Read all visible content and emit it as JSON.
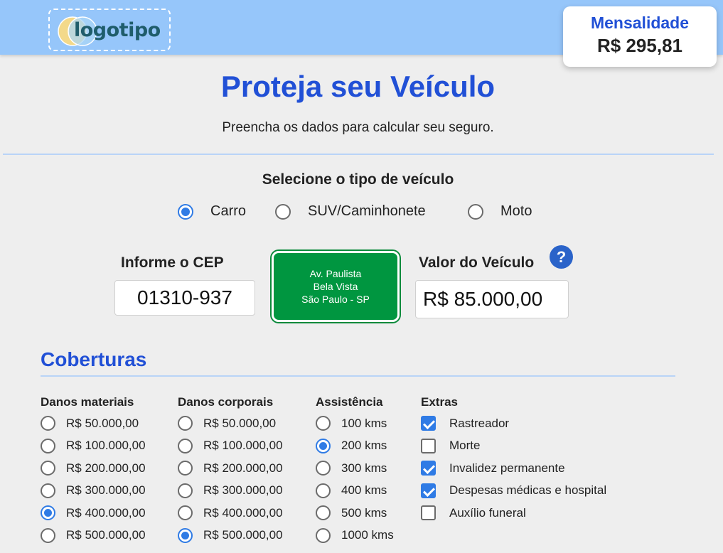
{
  "header": {
    "logo_text": "logotipo",
    "price_label": "Mensalidade",
    "price_value": "R$ 295,81"
  },
  "hero": {
    "title": "Proteja seu Veículo",
    "subtitle": "Preencha os dados para calcular seu seguro."
  },
  "vehicle_type": {
    "title": "Selecione o tipo de veículo",
    "options": [
      {
        "label": "Carro",
        "selected": true
      },
      {
        "label": "SUV/Caminhonete",
        "selected": false
      },
      {
        "label": "Moto",
        "selected": false
      }
    ]
  },
  "cep": {
    "label": "Informe o CEP",
    "value": "01310-937"
  },
  "address": {
    "street": "Av. Paulista",
    "district": "Bela Vista",
    "city": "São Paulo - SP"
  },
  "vehicle_value": {
    "label": "Valor do Veículo",
    "help_icon": "?",
    "value": "R$ 85.000,00"
  },
  "coverages": {
    "title": "Coberturas",
    "danos_materiais": {
      "title": "Danos materiais",
      "options": [
        "R$ 50.000,00",
        "R$ 100.000,00",
        "R$ 200.000,00",
        "R$ 300.000,00",
        "R$ 400.000,00",
        "R$ 500.000,00"
      ],
      "selected_index": 4
    },
    "danos_corporais": {
      "title": "Danos corporais",
      "options": [
        "R$ 50.000,00",
        "R$ 100.000,00",
        "R$ 200.000,00",
        "R$ 300.000,00",
        "R$ 400.000,00",
        "R$ 500.000,00"
      ],
      "selected_index": 5
    },
    "assistencia": {
      "title": "Assistência",
      "options": [
        "100 kms",
        "200 kms",
        "300 kms",
        "400 kms",
        "500 kms",
        "1000 kms"
      ],
      "selected_index": 1
    },
    "extras": {
      "title": "Extras",
      "items": [
        {
          "label": "Rastreador",
          "checked": true
        },
        {
          "label": "Morte",
          "checked": false
        },
        {
          "label": "Invalidez permanente",
          "checked": true
        },
        {
          "label": "Despesas médicas e hospital",
          "checked": true
        },
        {
          "label": "Auxílio funeral",
          "checked": false
        }
      ]
    }
  },
  "colors": {
    "header_bg": "#96c6fa",
    "accent_blue": "#2150d6",
    "radio_blue": "#2f7be5",
    "address_green": "#009640"
  }
}
